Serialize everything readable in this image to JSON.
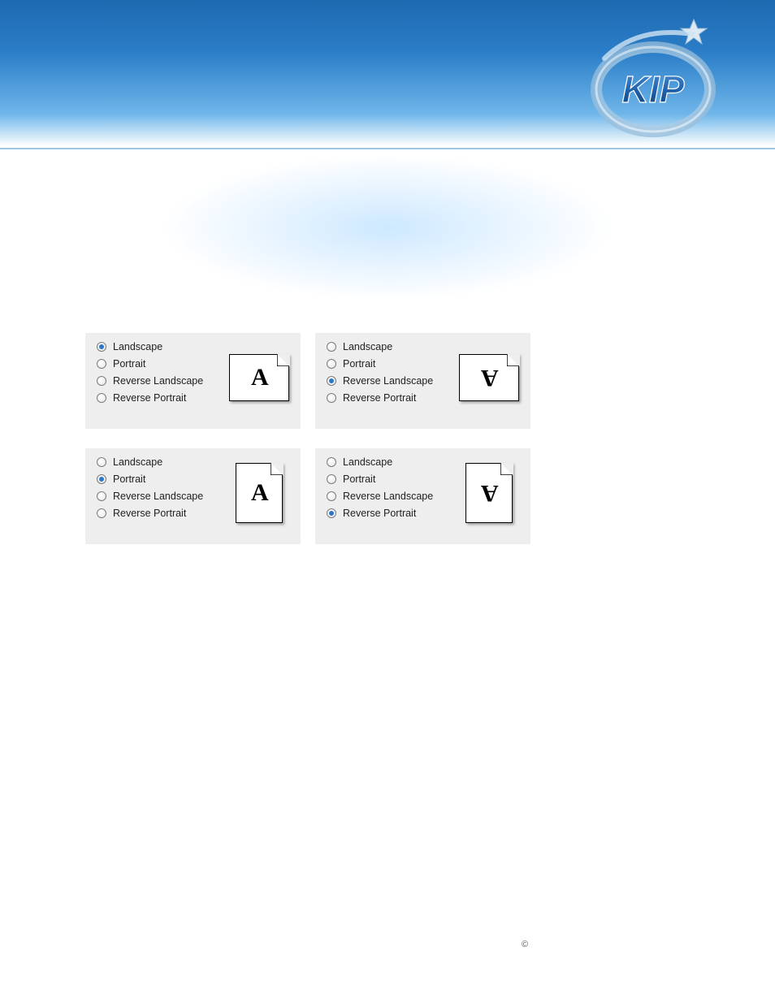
{
  "brand": {
    "name": "KIP"
  },
  "orientation_options": {
    "landscape": "Landscape",
    "portrait": "Portrait",
    "reverse_landscape": "Reverse Landscape",
    "reverse_portrait": "Reverse Portrait"
  },
  "panels": [
    {
      "id": "panel-landscape",
      "selected": "landscape",
      "preview_shape": "landscape",
      "preview_rotated": false
    },
    {
      "id": "panel-reverse-landscape",
      "selected": "reverse_landscape",
      "preview_shape": "landscape",
      "preview_rotated": true
    },
    {
      "id": "panel-portrait",
      "selected": "portrait",
      "preview_shape": "portrait",
      "preview_rotated": false
    },
    {
      "id": "panel-reverse-portrait",
      "selected": "reverse_portrait",
      "preview_shape": "portrait",
      "preview_rotated": true
    }
  ],
  "preview_glyph": "A",
  "footer": {
    "copyright_symbol": "©"
  }
}
